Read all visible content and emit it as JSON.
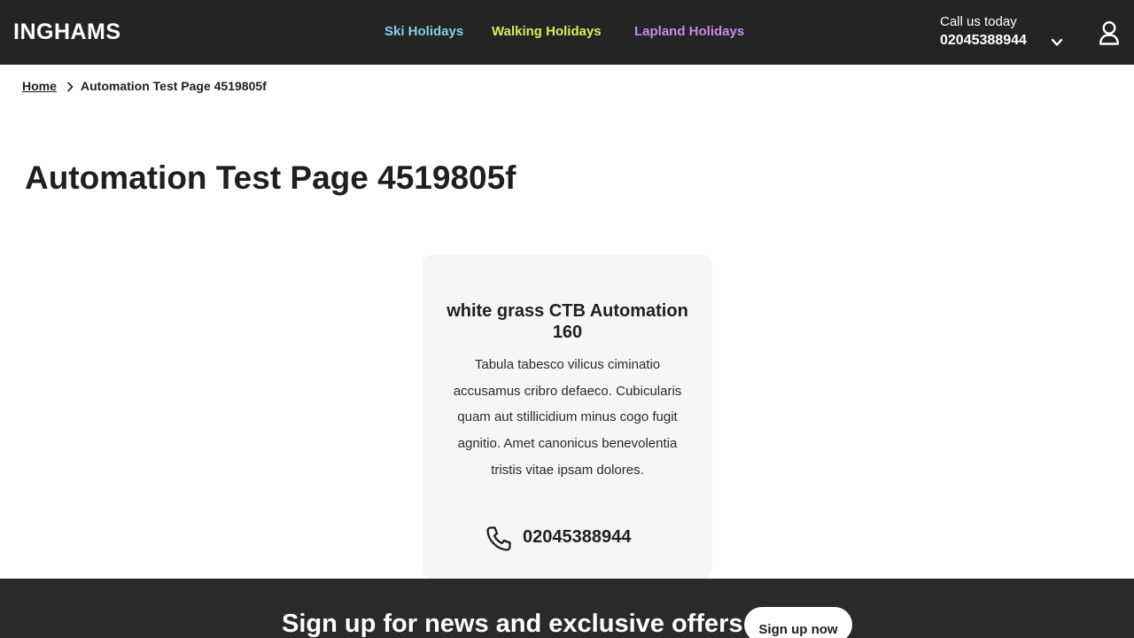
{
  "header": {
    "logo": "INGHAMS",
    "nav": [
      {
        "label": "Ski Holidays",
        "color": "#7fd3e6"
      },
      {
        "label": "Walking Holidays",
        "color": "#d6ee5a"
      },
      {
        "label": "Lapland Holidays",
        "color": "#c98af0"
      }
    ],
    "call_label": "Call us today",
    "call_number": "02045388944",
    "icons": {
      "dropdown": "chevron-down-icon",
      "account": "user-icon"
    }
  },
  "breadcrumb": {
    "home": "Home",
    "current": "Automation Test Page 4519805f",
    "separator_icon": "chevron-right-icon"
  },
  "page": {
    "title": "Automation Test Page 4519805f"
  },
  "card": {
    "title": "white grass CTB Automation 160",
    "body": "Tabula tabesco vilicus ciminatio accusamus cribro defaeco. Cubicularis quam aut stillicidium minus cogo fugit agnitio. Amet canonicus benevolentia tristis vitae ipsam dolores.",
    "phone_icon": "phone-icon",
    "phone": "02045388944",
    "background": "#f6f6f6"
  },
  "footer": {
    "signup_text": "Sign up for news and exclusive offers",
    "signup_button": "Sign up now",
    "background": "#2a2a2a"
  }
}
